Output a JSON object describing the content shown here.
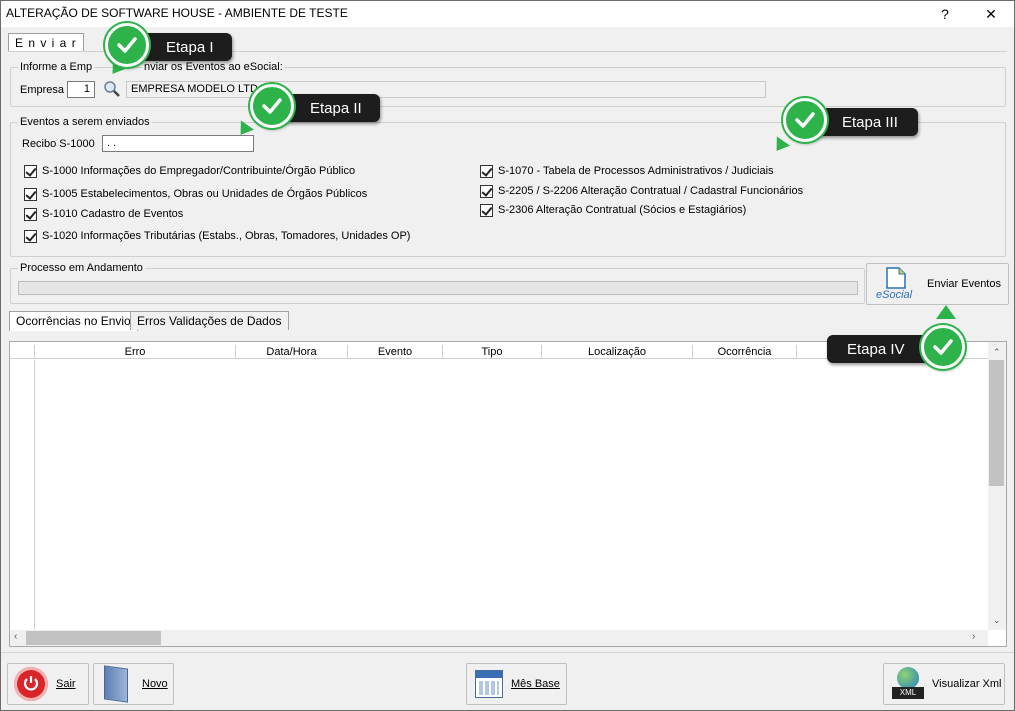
{
  "window": {
    "title": "ALTERAÇÃO DE SOFTWARE HOUSE - AMBIENTE DE TESTE",
    "help": "?",
    "close": "✕"
  },
  "top_tab": {
    "label": "E n v i a r"
  },
  "company_group": {
    "title_left": "Informe a Emp",
    "title_right": "nviar os Eventos ao eSocial:",
    "label": "Empresa",
    "code": "1",
    "name": "EMPRESA MODELO LTDA"
  },
  "events_group": {
    "title": "Eventos a serem enviados",
    "recibo_label": "Recibo S-1000",
    "recibo_value": ". .",
    "left": [
      "S-1000 Informações do Empregador/Contribuinte/Órgão Público",
      "S-1005 Estabelecimentos, Obras ou Unidades de Órgãos Públicos",
      "S-1010 Cadastro de Eventos",
      "S-1020 Informações Tributárias (Estabs., Obras, Tomadores, Unidades OP)"
    ],
    "right": [
      "S-1070 - Tabela de Processos Administrativos / Judiciais",
      "S-2205 / S-2206 Alteração Contratual / Cadastral Funcionários",
      "S-2306 Alteração Contratual (Sócios e Estagiários)"
    ]
  },
  "progress": {
    "title": "Processo em Andamento",
    "value": 0
  },
  "send_button": {
    "logo": "eSocial",
    "label": "Enviar Eventos"
  },
  "lower_tabs": [
    "Ocorrências no Envio",
    "Erros Validações de Dados"
  ],
  "grid": {
    "columns": [
      "Erro",
      "Data/Hora",
      "Evento",
      "Tipo",
      "Localização",
      "Ocorrência"
    ]
  },
  "bottom": {
    "exit": "Sair",
    "new": "Novo",
    "month": "Mês Base",
    "xml": "Visualizar Xml",
    "xml_badge": "XML"
  },
  "callouts": [
    "Etapa I",
    "Etapa II",
    "Etapa III",
    "Etapa IV"
  ],
  "colors": {
    "accent_green": "#2db34a",
    "callout_bg": "#1d1d1d"
  }
}
